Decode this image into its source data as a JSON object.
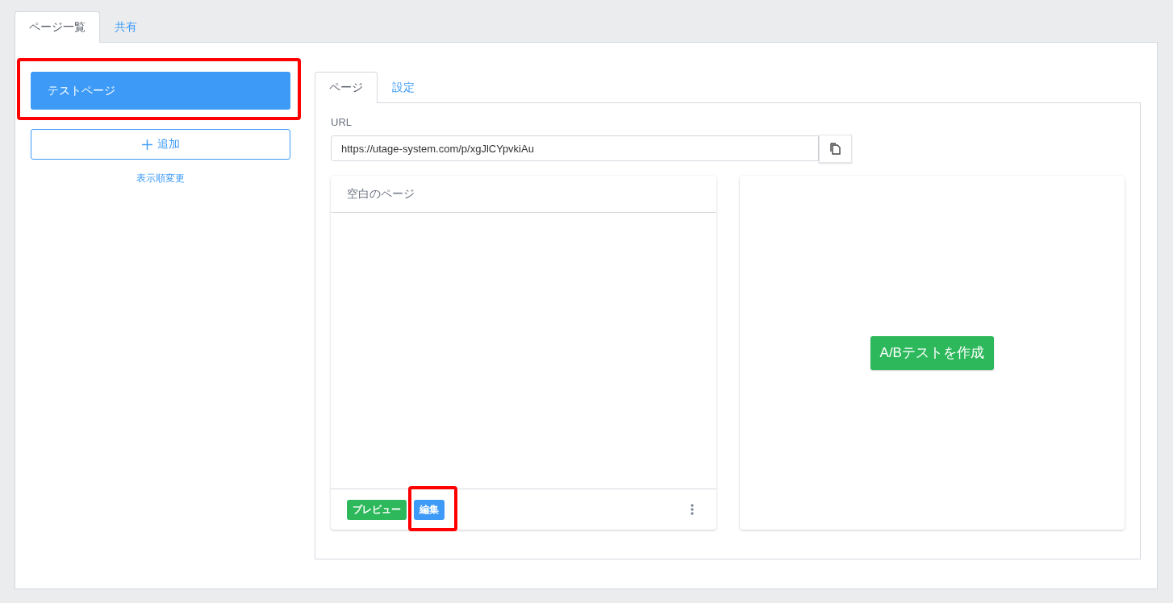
{
  "outer_tabs": [
    {
      "label": "ページ一覧",
      "selected": true
    },
    {
      "label": "共有",
      "selected": false
    }
  ],
  "sidebar": {
    "pages": [
      {
        "label": "テストページ",
        "selected": true,
        "highlighted": true
      }
    ],
    "add_button": "追加",
    "reorder_link": "表示順変更"
  },
  "inner_tabs": [
    {
      "label": "ページ",
      "selected": true
    },
    {
      "label": "設定",
      "selected": false
    }
  ],
  "url_field": {
    "label": "URL",
    "value": "https://utage-system.com/p/xgJlCYpvkiAu"
  },
  "page_card": {
    "title": "空白のページ",
    "buttons": [
      {
        "label": "プレビュー",
        "kind": "preview",
        "highlighted": false
      },
      {
        "label": "編集",
        "kind": "edit",
        "highlighted": true
      }
    ]
  },
  "ab_test_button": "A/Bテストを作成"
}
